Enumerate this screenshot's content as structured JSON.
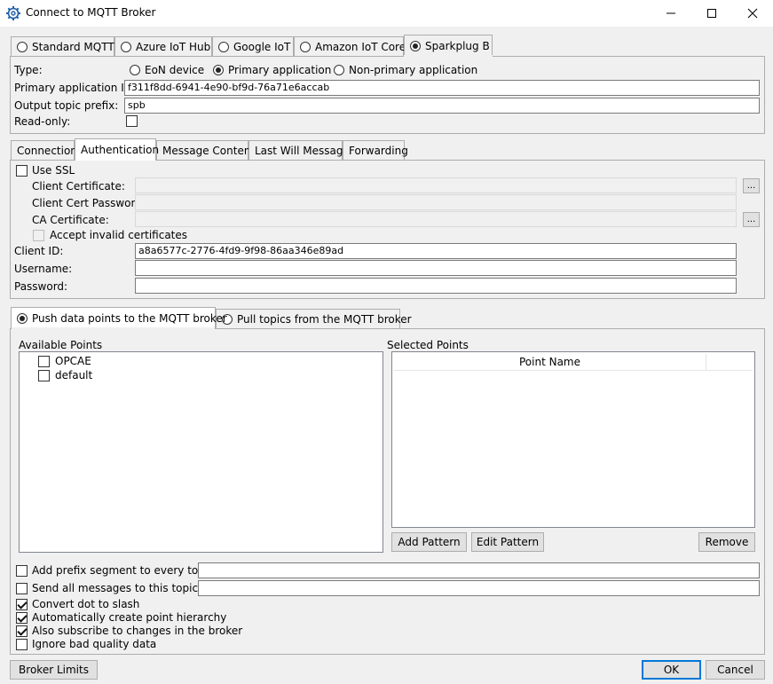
{
  "window": {
    "title": "Connect to MQTT Broker"
  },
  "broker_tabs": [
    {
      "label": "Standard MQTT",
      "selected": false
    },
    {
      "label": "Azure IoT Hub",
      "selected": false
    },
    {
      "label": "Google IoT",
      "selected": false
    },
    {
      "label": "Amazon IoT Core",
      "selected": false
    },
    {
      "label": "Sparkplug B",
      "selected": true
    }
  ],
  "sparkplug": {
    "type_label": "Type:",
    "types": [
      {
        "label": "EoN device",
        "selected": false
      },
      {
        "label": "Primary application",
        "selected": true
      },
      {
        "label": "Non-primary application",
        "selected": false
      }
    ],
    "primary_app_id_label": "Primary application ID:",
    "primary_app_id_value": "f311f8dd-6941-4e90-bf9d-76a71e6accab",
    "output_prefix_label": "Output topic prefix:",
    "output_prefix_value": "spb",
    "readonly_label": "Read-only:"
  },
  "settings_tabs": [
    {
      "label": "Connection"
    },
    {
      "label": "Authentication"
    },
    {
      "label": "Message Content"
    },
    {
      "label": "Last Will Message"
    },
    {
      "label": "Forwarding"
    }
  ],
  "auth": {
    "use_ssl_label": "Use SSL",
    "client_cert_label": "Client Certificate:",
    "client_cert_password_label": "Client Cert Password:",
    "ca_cert_label": "CA Certificate:",
    "browse_label": "...",
    "accept_invalid_label": "Accept invalid certificates",
    "client_id_label": "Client ID:",
    "client_id_value": "a8a6577c-2776-4fd9-9f98-86aa346e89ad",
    "username_label": "Username:",
    "username_value": "",
    "password_label": "Password:",
    "password_value": ""
  },
  "direction_tabs": [
    {
      "label": "Push data points to the MQTT broker",
      "selected": true
    },
    {
      "label": "Pull topics from the MQTT broker",
      "selected": false
    }
  ],
  "points": {
    "available_label": "Available Points",
    "available_items": [
      "OPCAE",
      "default"
    ],
    "selected_label": "Selected Points",
    "column_point_name": "Point Name",
    "add_pattern": "Add Pattern",
    "edit_pattern": "Edit Pattern",
    "remove": "Remove"
  },
  "options": {
    "add_prefix_label": "Add prefix segment to every topic:",
    "add_prefix_value": "",
    "send_all_label": "Send all messages to this topic:",
    "send_all_value": "",
    "convert_dot_label": "Convert dot to slash",
    "auto_hierarchy_label": "Automatically create point hierarchy",
    "also_subscribe_label": "Also subscribe to changes in the broker",
    "ignore_bad_label": "Ignore bad quality data"
  },
  "footer": {
    "broker_limits": "Broker Limits",
    "ok": "OK",
    "cancel": "Cancel"
  }
}
